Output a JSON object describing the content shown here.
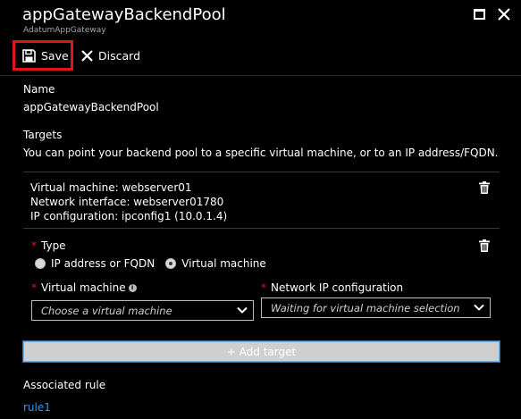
{
  "header": {
    "title": "appGatewayBackendPool",
    "subtitle": "AdatumAppGateway"
  },
  "toolbar": {
    "save_label": "Save",
    "discard_label": "Discard"
  },
  "form": {
    "name_label": "Name",
    "name_value": "appGatewayBackendPool",
    "targets_label": "Targets",
    "targets_description": "You can point your backend pool to a specific virtual machine, or to an IP address/FQDN."
  },
  "existing_target": {
    "line1": "Virtual machine: webserver01",
    "line2": "Network interface: webserver01780",
    "line3": "IP configuration: ipconfig1 (10.0.1.4)"
  },
  "new_target": {
    "required_mark": "*",
    "type_label": "Type",
    "type_options": [
      "IP address or FQDN",
      "Virtual machine"
    ],
    "type_selected": "Virtual machine",
    "vm_label": "Virtual machine",
    "vm_placeholder": "Choose a virtual machine",
    "nic_label": "Network IP configuration",
    "nic_placeholder": "Waiting for virtual machine selection"
  },
  "add_target_label": "+ Add target",
  "associated": {
    "label": "Associated rule",
    "rule_link": "rule1"
  }
}
